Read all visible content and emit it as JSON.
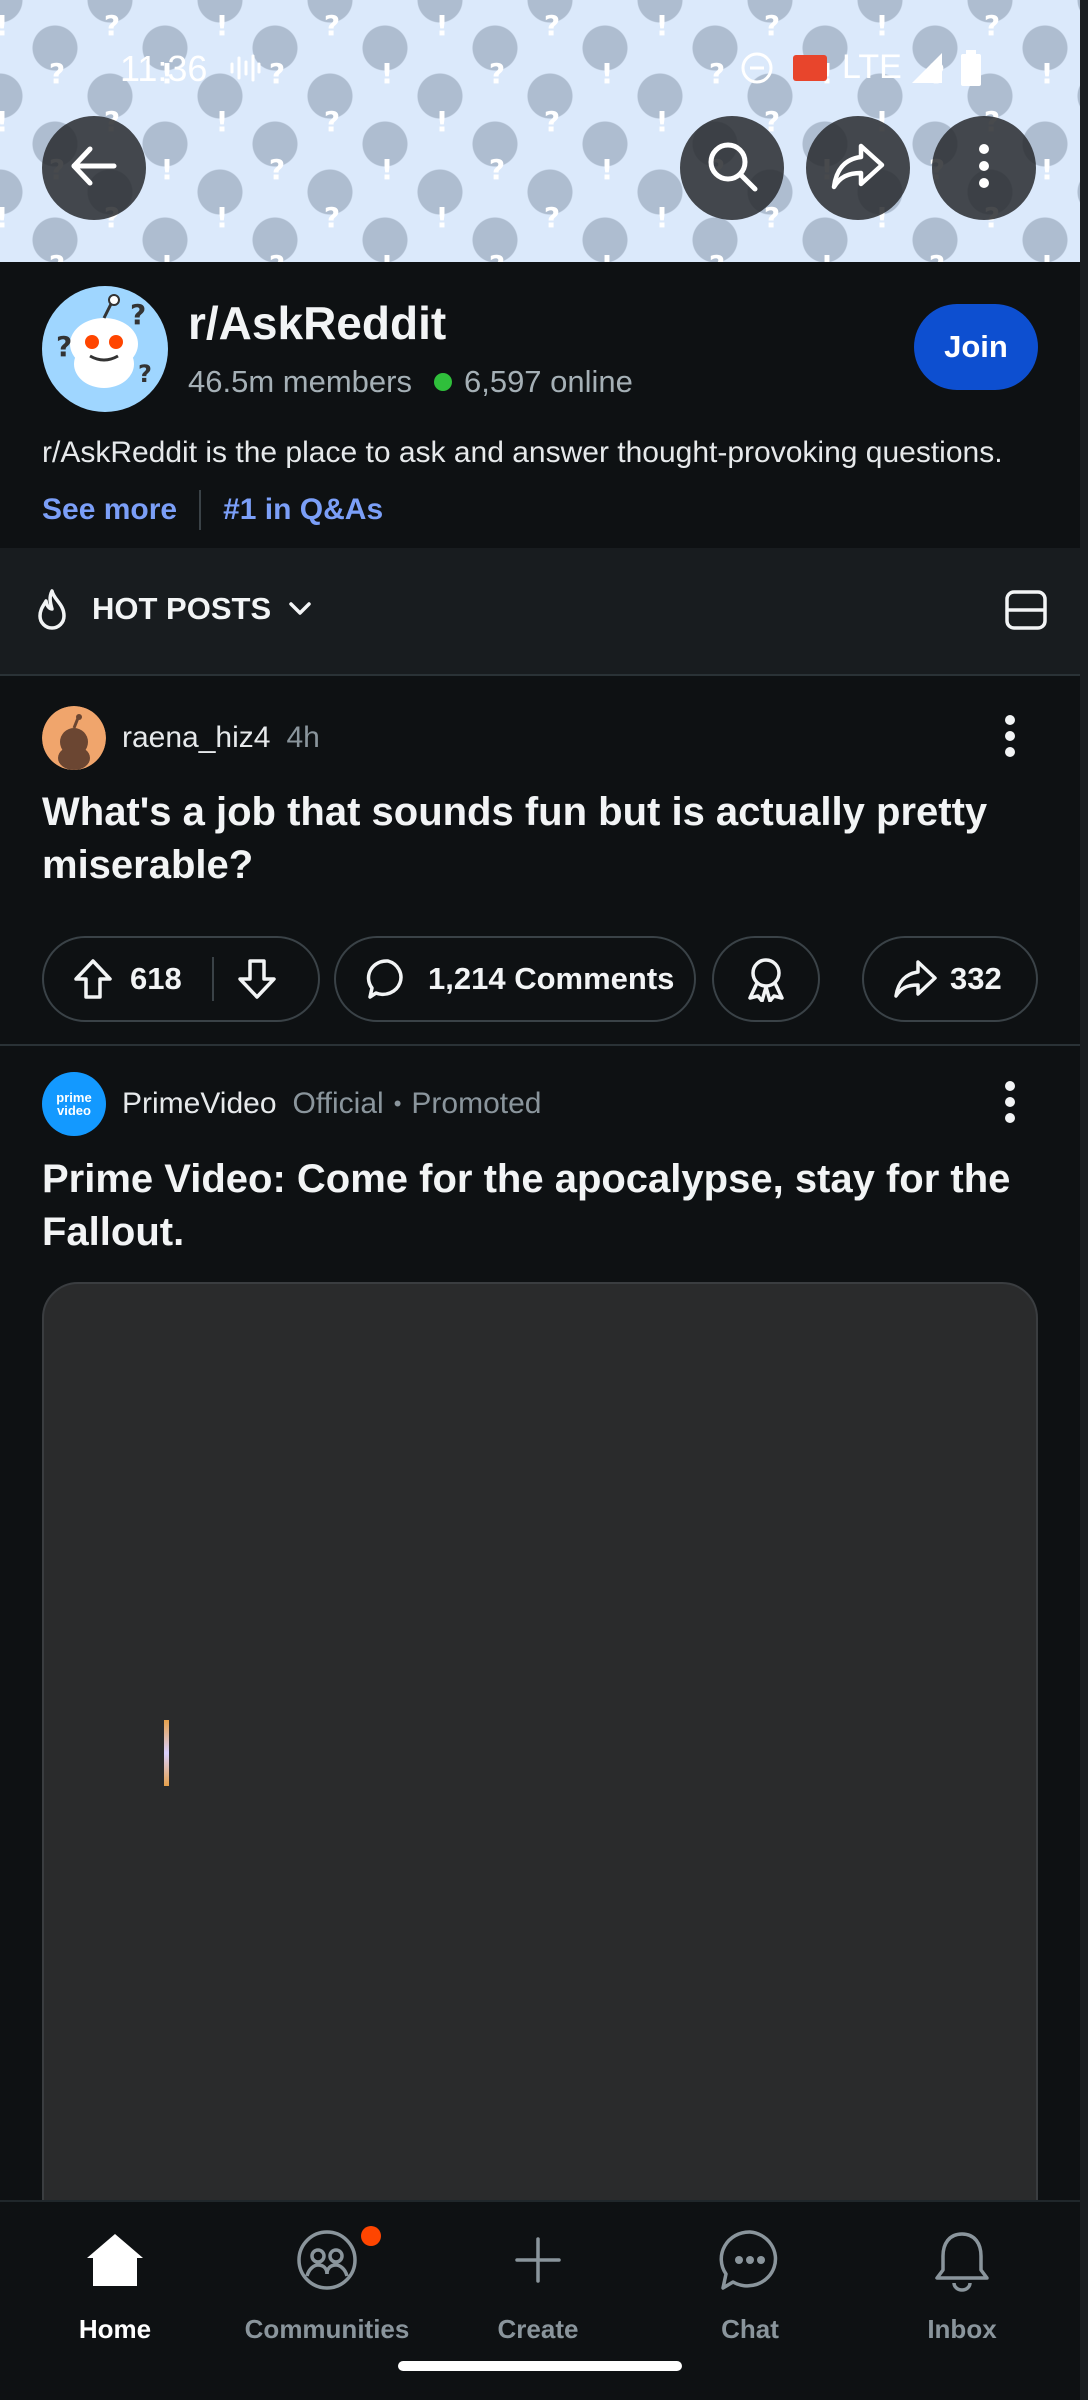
{
  "status_bar": {
    "time": "11:36",
    "network": "LTE"
  },
  "top_actions": {
    "back_icon": "arrow-left-icon",
    "search_icon": "search-icon",
    "share_icon": "share-icon",
    "more_icon": "more-vertical-icon"
  },
  "subreddit": {
    "name": "r/AskReddit",
    "members": "46.5m members",
    "online": "6,597 online",
    "join_label": "Join",
    "description": "r/AskReddit is the place to ask and answer thought-provoking questions.",
    "see_more": "See more",
    "rank": "#1 in Q&As"
  },
  "sort_bar": {
    "label": "HOT POSTS"
  },
  "posts": [
    {
      "username": "raena_hiz4",
      "time": "4h",
      "title": "What's a job that sounds fun but is actually pretty miserable?",
      "votes": "618",
      "comments": "1,214 Comments",
      "shares": "332"
    }
  ],
  "promoted": {
    "username": "PrimeVideo",
    "avatar_text_1": "prime",
    "avatar_text_2": "video",
    "official": "Official",
    "promoted": "Promoted",
    "separator": "•",
    "title": "Prime Video: Come for the apocalypse, stay for the Fallout."
  },
  "bottom_nav": {
    "items": [
      {
        "label": "Home"
      },
      {
        "label": "Communities"
      },
      {
        "label": "Create"
      },
      {
        "label": "Chat"
      },
      {
        "label": "Inbox"
      }
    ]
  },
  "colors": {
    "background": "#0e1113",
    "join": "#0d4fd0",
    "link": "#7b9ff8",
    "online": "#2fbf3b",
    "badge": "#ff4500"
  }
}
